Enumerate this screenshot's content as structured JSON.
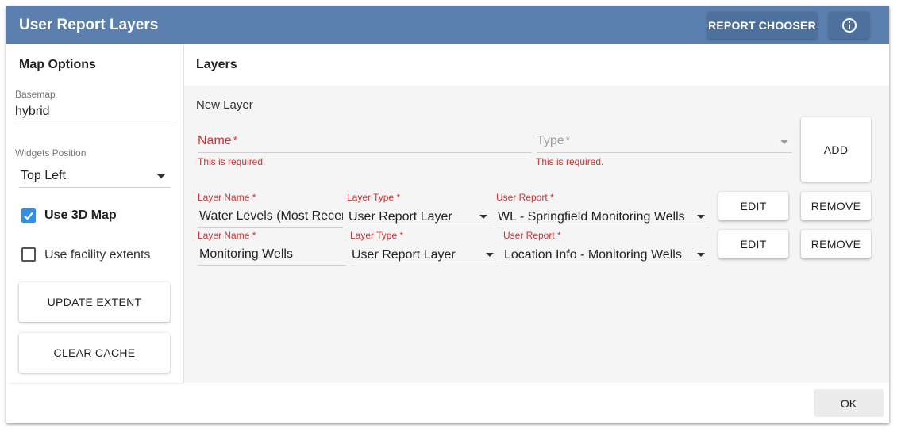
{
  "title": "User Report Layers",
  "toolbar": {
    "report_chooser": "REPORT CHOOSER",
    "info_icon": "info-icon"
  },
  "map_options": {
    "heading": "Map Options",
    "basemap_label": "Basemap",
    "basemap_value": "hybrid",
    "widgets_label": "Widgets Position",
    "widgets_value": "Top Left",
    "use_3d": {
      "label": "Use 3D Map",
      "checked": true
    },
    "use_facility": {
      "label": "Use facility extents",
      "checked": false
    },
    "update_extent": "UPDATE EXTENT",
    "clear_cache": "CLEAR CACHE"
  },
  "layers": {
    "heading": "Layers",
    "new_layer": {
      "heading": "New Layer",
      "name_placeholder": "Name",
      "type_placeholder": "Type",
      "required_mark": "*",
      "name_error": "This is required.",
      "type_error": "This is required.",
      "add_button": "ADD"
    },
    "field_labels": {
      "layer_name": "Layer Name",
      "layer_type": "Layer Type",
      "user_report": "User Report"
    },
    "rows": [
      {
        "layer_name": "Water Levels (Most Recent)",
        "layer_type": "User Report Layer",
        "user_report": "WL - Springfield Monitoring Wells",
        "edit": "EDIT",
        "remove": "REMOVE"
      },
      {
        "layer_name": "Monitoring Wells",
        "layer_type": "User Report Layer",
        "user_report": "Location Info - Monitoring Wells",
        "edit": "EDIT",
        "remove": "REMOVE"
      }
    ]
  },
  "footer": {
    "ok": "OK"
  },
  "colors": {
    "header": "#5b7fae",
    "accent": "#2f8fea",
    "error": "#d32f2f"
  }
}
